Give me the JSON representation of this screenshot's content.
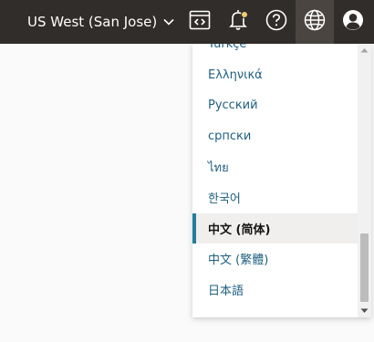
{
  "header": {
    "region_label": "US West (San Jose)",
    "icons": {
      "region_chevron": "chevron-down-icon",
      "code_editor": "code-editor-icon",
      "notifications": "bell-icon",
      "help": "help-icon",
      "language": "globe-icon",
      "profile": "user-icon"
    }
  },
  "language_menu": {
    "items": [
      {
        "label": "Türkçe"
      },
      {
        "label": "Ελληνικά"
      },
      {
        "label": "Русский"
      },
      {
        "label": "српски"
      },
      {
        "label": "ไทย"
      },
      {
        "label": "한국어"
      },
      {
        "label": "中文 (简体)"
      },
      {
        "label": "中文 (繁體)"
      },
      {
        "label": "日本語"
      }
    ],
    "selected_index": 6
  },
  "colors": {
    "topbar_bg": "#312d2a",
    "link": "#1f5f80",
    "selected_accent": "#227e9e",
    "notification_dot": "#f0cc71"
  }
}
